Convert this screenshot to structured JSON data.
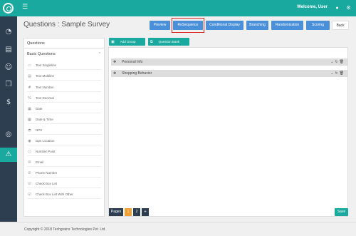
{
  "topbar": {
    "logo_icon": "app-logo-icon",
    "menu_icon": "hamburger-icon",
    "welcome": "Welcome, User",
    "user_icon": "user-icon",
    "settings_icon": "gear-icon"
  },
  "rail": [
    "dashboard-icon",
    "book-icon",
    "user-icon",
    "box-icon",
    "dollar-icon",
    "lifebuoy-icon",
    "warning-icon"
  ],
  "page": {
    "title": "Questions : Sample Survey"
  },
  "header_buttons": {
    "preview": "Preview",
    "resequence": "ReSequence",
    "conditional": "Conditional Display",
    "branching": "Branching",
    "randomization": "Randomization",
    "scoring": "Scoring",
    "back": "Back"
  },
  "palette": {
    "header": "Questions",
    "section": "Basic Questions",
    "items": [
      "Text Singleline",
      "Text Multiline",
      "Text Number",
      "Text Decimal",
      "Date",
      "Date & Time",
      "NPS",
      "Gps Location",
      "Number Point",
      "Email",
      "Phone Number",
      "Check Box List",
      "Check Box List With Other"
    ]
  },
  "actions": {
    "add_group": "Add Group",
    "question_bank": "Question Bank"
  },
  "groups": [
    "Personal Info",
    "Shopping Behavior"
  ],
  "pager": {
    "label": "Pages",
    "page1": "1",
    "page2": "2",
    "add": "+"
  },
  "save": "Save",
  "footer": {
    "copyright": "Copyright © 2018 Techgrains Technologies Pvt. Ltd."
  },
  "colors": {
    "accent": "#1aa99e",
    "rail": "#2c3e50",
    "button": "#4a90d9",
    "highlight": "#dd2222",
    "page_active": "#f0a030"
  }
}
